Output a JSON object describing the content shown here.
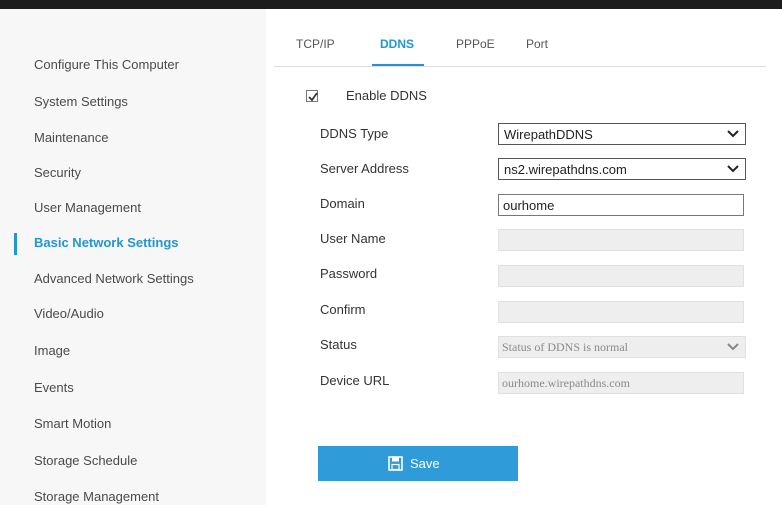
{
  "sidebar": {
    "items": [
      {
        "label": "Configure This Computer",
        "active": false
      },
      {
        "label": "System Settings",
        "active": false
      },
      {
        "label": "Maintenance",
        "active": false
      },
      {
        "label": "Security",
        "active": false
      },
      {
        "label": "User Management",
        "active": false
      },
      {
        "label": "Basic Network Settings",
        "active": true
      },
      {
        "label": "Advanced Network Settings",
        "active": false
      },
      {
        "label": "Video/Audio",
        "active": false
      },
      {
        "label": "Image",
        "active": false
      },
      {
        "label": "Events",
        "active": false
      },
      {
        "label": "Smart Motion",
        "active": false
      },
      {
        "label": "Storage Schedule",
        "active": false
      },
      {
        "label": "Storage Management",
        "active": false
      }
    ]
  },
  "tabs": [
    {
      "label": "TCP/IP",
      "active": false
    },
    {
      "label": "DDNS",
      "active": true
    },
    {
      "label": "PPPoE",
      "active": false
    },
    {
      "label": "Port",
      "active": false
    }
  ],
  "form": {
    "enable_ddns": {
      "label": "Enable DDNS",
      "checked": true
    },
    "ddns_type": {
      "label": "DDNS Type",
      "value": "WirepathDDNS"
    },
    "server_address": {
      "label": "Server Address",
      "value": "ns2.wirepathdns.com"
    },
    "domain": {
      "label": "Domain",
      "value": "ourhome"
    },
    "user_name": {
      "label": "User Name",
      "value": ""
    },
    "password": {
      "label": "Password",
      "value": ""
    },
    "confirm": {
      "label": "Confirm",
      "value": ""
    },
    "status": {
      "label": "Status",
      "value": "Status of DDNS is normal"
    },
    "device_url": {
      "label": "Device URL",
      "value": "ourhome.wirepathdns.com"
    }
  },
  "save_button": {
    "label": "Save",
    "icon": "floppy-disk-icon"
  },
  "colors": {
    "accent": "#2196d3",
    "save_button": "#2f9bd9",
    "topbar": "#1c1c1c",
    "sidebar_bg": "#f7f7f7",
    "disabled_field": "#eeeeee"
  }
}
